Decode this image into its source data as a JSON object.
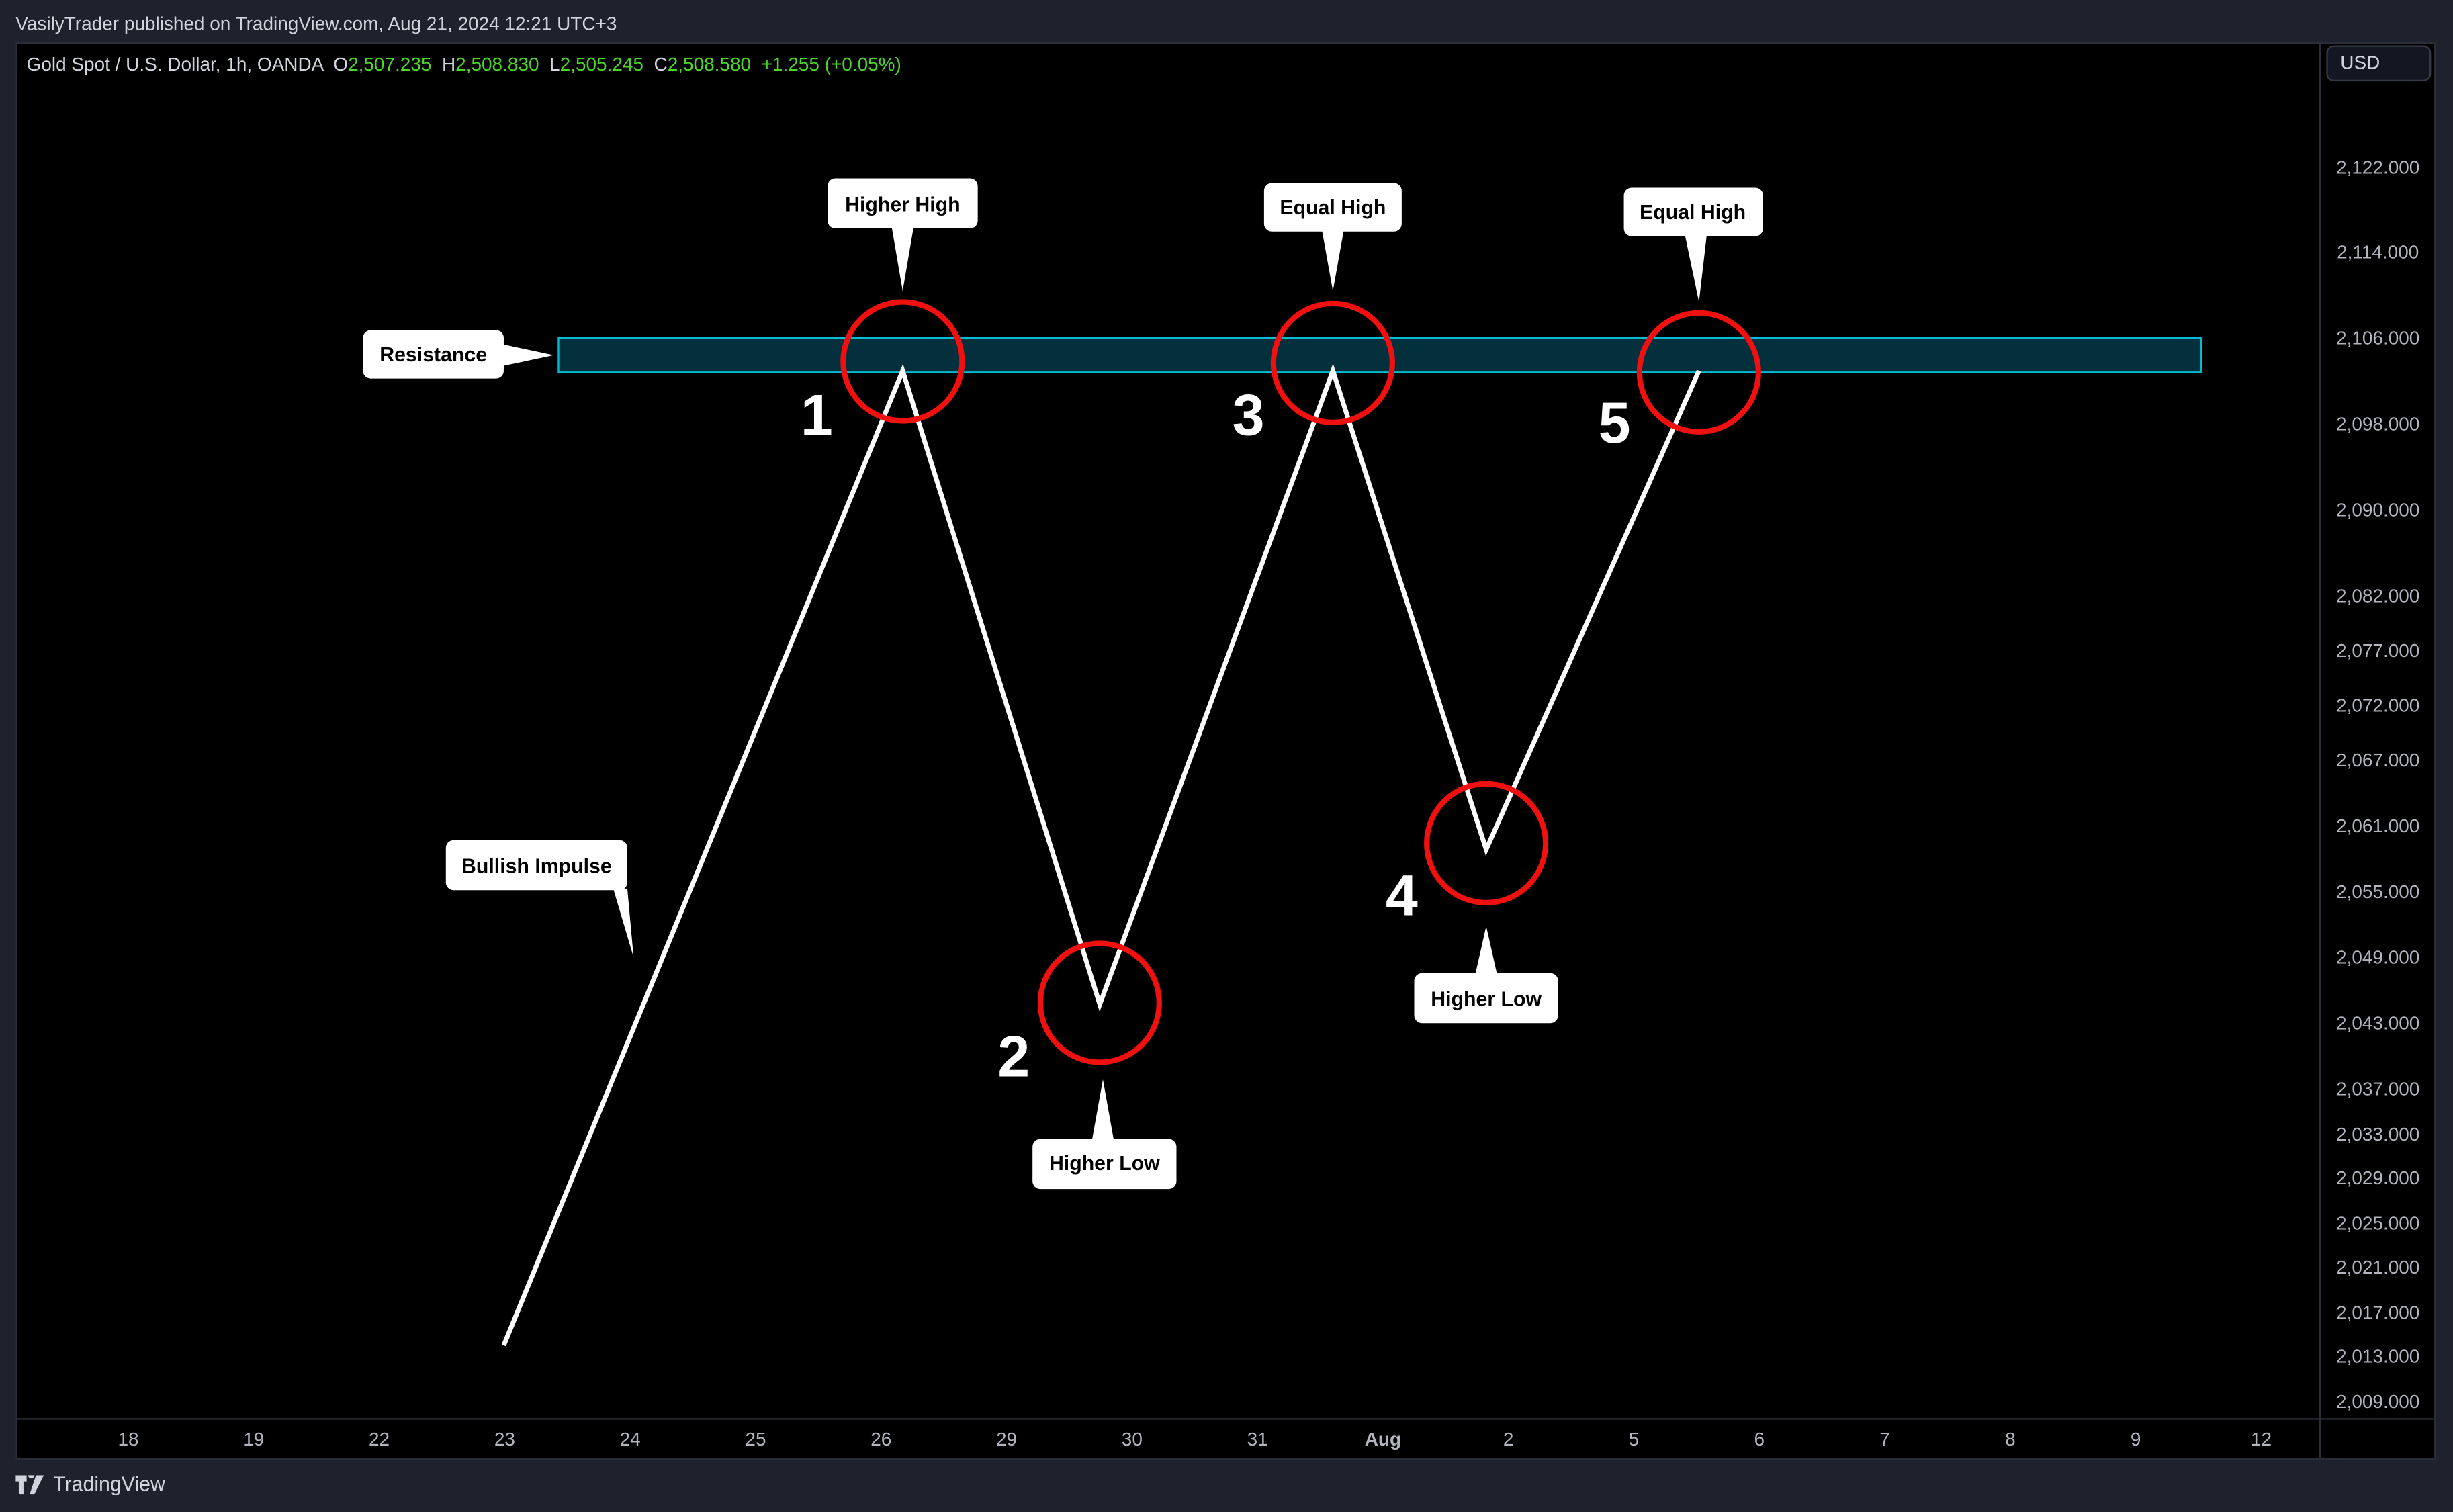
{
  "header": {
    "published": "VasilyTrader published on TradingView.com, Aug 21, 2024 12:21 UTC+3"
  },
  "legend": {
    "symbol": "Gold Spot / U.S. Dollar, 1h, OANDA",
    "o_label": "O",
    "o": "2,507.235",
    "h_label": "H",
    "h": "2,508.830",
    "l_label": "L",
    "l": "2,505.245",
    "c_label": "C",
    "c": "2,508.580",
    "change": "+1.255 (+0.05%)"
  },
  "currency_button": "USD",
  "y_axis": [
    "2,122.000",
    "2,114.000",
    "2,106.000",
    "2,098.000",
    "2,090.000",
    "2,082.000",
    "2,077.000",
    "2,072.000",
    "2,067.000",
    "2,061.000",
    "2,055.000",
    "2,049.000",
    "2,043.000",
    "2,037.000",
    "2,033.000",
    "2,029.000",
    "2,025.000",
    "2,021.000",
    "2,017.000",
    "2,013.000",
    "2,009.000"
  ],
  "x_axis": [
    "18",
    "19",
    "22",
    "23",
    "24",
    "25",
    "26",
    "29",
    "30",
    "31",
    "Aug",
    "2",
    "5",
    "6",
    "7",
    "8",
    "9",
    "12"
  ],
  "annotations": {
    "resistance": "Resistance",
    "bullish_impulse": "Bullish Impulse",
    "higher_high": "Higher High",
    "equal_high_1": "Equal High",
    "equal_high_2": "Equal High",
    "higher_low_1": "Higher Low",
    "higher_low_2": "Higher Low",
    "points": [
      "1",
      "2",
      "3",
      "4",
      "5"
    ]
  },
  "colors": {
    "background": "#000000",
    "zone_fill": "#04303d",
    "zone_border": "#00bcd4",
    "circle": "#f01010",
    "path": "#ffffff",
    "ohlc_value": "#4cd626"
  },
  "footer": {
    "brand": "TradingView"
  }
}
